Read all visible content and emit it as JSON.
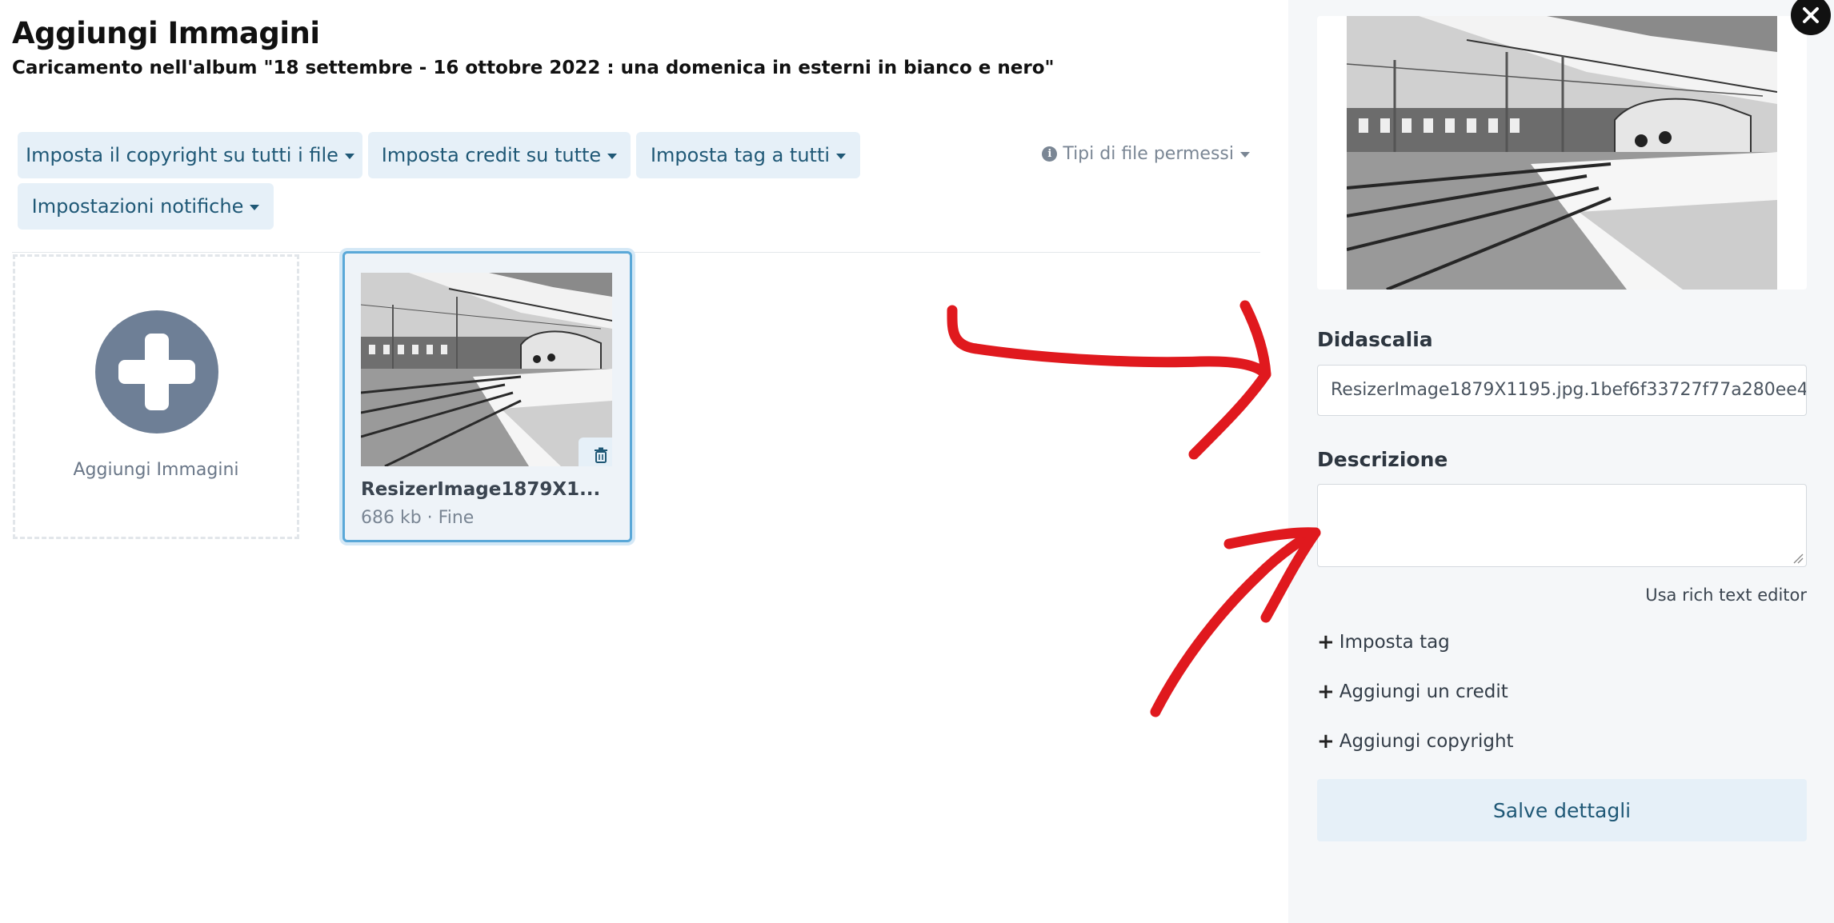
{
  "header": {
    "title": "Aggiungi Immagini",
    "subtitle": "Caricamento nell'album \"18 settembre - 16 ottobre 2022 : una domenica in esterni in bianco e nero\""
  },
  "toolbar": {
    "copyright_all": "Imposta il copyright su tutti i file",
    "credit_all": "Imposta credit su tutte",
    "tag_all": "Imposta tag a tutti",
    "notifications": "Impostazioni notifiche",
    "file_types": "Tipi di file permessi"
  },
  "uploader": {
    "add_label": "Aggiungi Immagini",
    "files": [
      {
        "name": "ResizerImage1879X1...",
        "meta": "686 kb · Fine"
      }
    ]
  },
  "panel": {
    "caption_label": "Didascalia",
    "caption_value": "ResizerImage1879X1195.jpg.1bef6f33727f77a280ee4",
    "description_label": "Descrizione",
    "description_value": "",
    "rich_text_link": "Usa rich text editor",
    "set_tag": "Imposta tag",
    "add_credit": "Aggiungi un credit",
    "add_copyright": "Aggiungi copyright",
    "save_button": "Salve dettagli"
  },
  "colors": {
    "button_bg": "#e6f0f8",
    "button_text": "#1f5876",
    "selected_border": "#5aa8d8",
    "annotation_red": "#e0191e"
  }
}
